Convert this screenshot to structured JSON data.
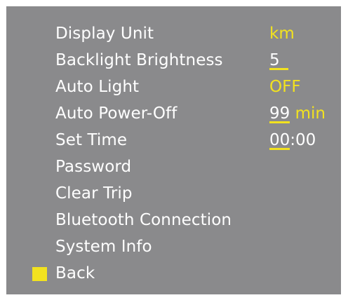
{
  "menu": {
    "items": [
      {
        "label": "Display Unit"
      },
      {
        "label": "Backlight Brightness"
      },
      {
        "label": "Auto Light"
      },
      {
        "label": "Auto Power-Off"
      },
      {
        "label": "Set Time"
      },
      {
        "label": "Password"
      },
      {
        "label": "Clear Trip"
      },
      {
        "label": "Bluetooth Connection"
      },
      {
        "label": "System Info"
      },
      {
        "label": "Back"
      }
    ],
    "selected_index": 9
  },
  "values": {
    "display_unit": "km",
    "backlight_brightness": "5",
    "auto_light": "OFF",
    "auto_power_off_value": "99",
    "auto_power_off_unit": "min",
    "set_time_hours": "00",
    "set_time_rest": ":00"
  },
  "colors": {
    "background": "#8a8a8c",
    "text": "#ffffff",
    "accent": "#f2e21f"
  },
  "icons": {
    "selection": "yellow-square-cursor-icon"
  }
}
